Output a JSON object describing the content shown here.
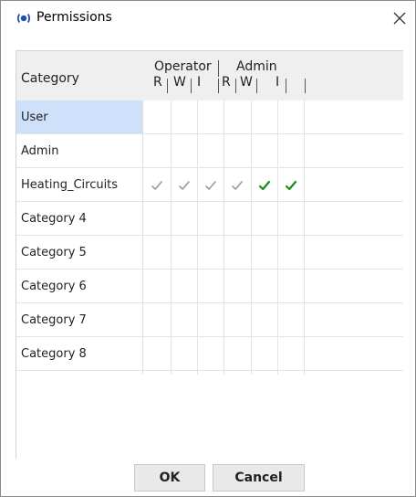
{
  "window": {
    "title": "Permissions",
    "icon": "eye-icon",
    "close_icon": "close-icon"
  },
  "table": {
    "category_header": "Category",
    "groups": [
      {
        "name": "Operator",
        "subcolumns": [
          "R",
          "W",
          "I"
        ]
      },
      {
        "name": "Admin",
        "subcolumns": [
          "R",
          "W",
          "I"
        ]
      }
    ],
    "rows": [
      {
        "label": "User",
        "selected": true,
        "permissions": [
          false,
          false,
          false,
          false,
          false,
          false
        ]
      },
      {
        "label": "Admin",
        "selected": false,
        "permissions": [
          false,
          false,
          false,
          false,
          false,
          false
        ]
      },
      {
        "label": "Heating_Circuits",
        "selected": false,
        "permissions": [
          "inherited",
          "inherited",
          "inherited",
          "inherited",
          "granted",
          "granted"
        ]
      },
      {
        "label": "Category 4",
        "selected": false,
        "permissions": [
          false,
          false,
          false,
          false,
          false,
          false
        ]
      },
      {
        "label": "Category 5",
        "selected": false,
        "permissions": [
          false,
          false,
          false,
          false,
          false,
          false
        ]
      },
      {
        "label": "Category 6",
        "selected": false,
        "permissions": [
          false,
          false,
          false,
          false,
          false,
          false
        ]
      },
      {
        "label": "Category 7",
        "selected": false,
        "permissions": [
          false,
          false,
          false,
          false,
          false,
          false
        ]
      },
      {
        "label": "Category 8",
        "selected": false,
        "permissions": [
          false,
          false,
          false,
          false,
          false,
          false
        ]
      }
    ]
  },
  "buttons": {
    "ok": "OK",
    "cancel": "Cancel"
  },
  "colors": {
    "selected_row": "#cfe0fb",
    "check_granted": "#1a8a1a",
    "check_inherited": "#9a9a9a",
    "header_bg": "#efefef"
  }
}
